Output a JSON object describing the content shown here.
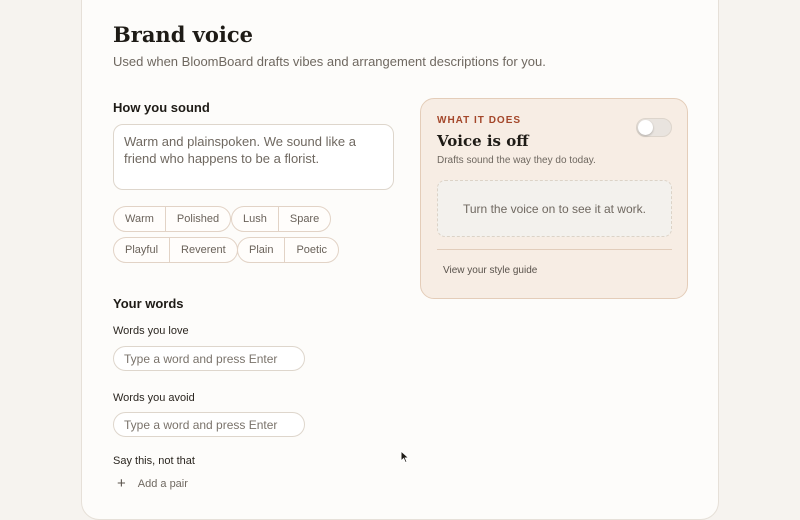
{
  "header": {
    "title": "Brand voice",
    "subtitle": "Used when BloomBoard drafts vibes and arrangement descriptions for you."
  },
  "how_you_sound": {
    "heading": "How you sound",
    "textarea_value": "Warm and plainspoken. We sound like a friend who happens to be a florist.",
    "tone_pairs": [
      [
        "Warm",
        "Polished"
      ],
      [
        "Lush",
        "Spare"
      ],
      [
        "Playful",
        "Reverent"
      ],
      [
        "Plain",
        "Poetic"
      ]
    ]
  },
  "your_words": {
    "heading": "Your words",
    "love_label": "Words you love",
    "love_placeholder": "Type a word and press Enter",
    "avoid_label": "Words you avoid",
    "avoid_placeholder": "Type a word and press Enter",
    "pairs_label": "Say this, not that",
    "add_pair_label": "Add a pair"
  },
  "panel": {
    "eyebrow": "WHAT IT DOES",
    "title": "Voice is off",
    "subtitle": "Drafts sound the way they do today.",
    "toggle_on": false,
    "preview_text": "Turn the voice on to see it at work.",
    "link_label": "View your style guide"
  },
  "colors": {
    "accent": "#a4472a",
    "panel_bg": "#f7ede4",
    "page_bg": "#f6f3ef"
  },
  "icons": [
    "plus-icon",
    "pointer-cursor-icon"
  ]
}
